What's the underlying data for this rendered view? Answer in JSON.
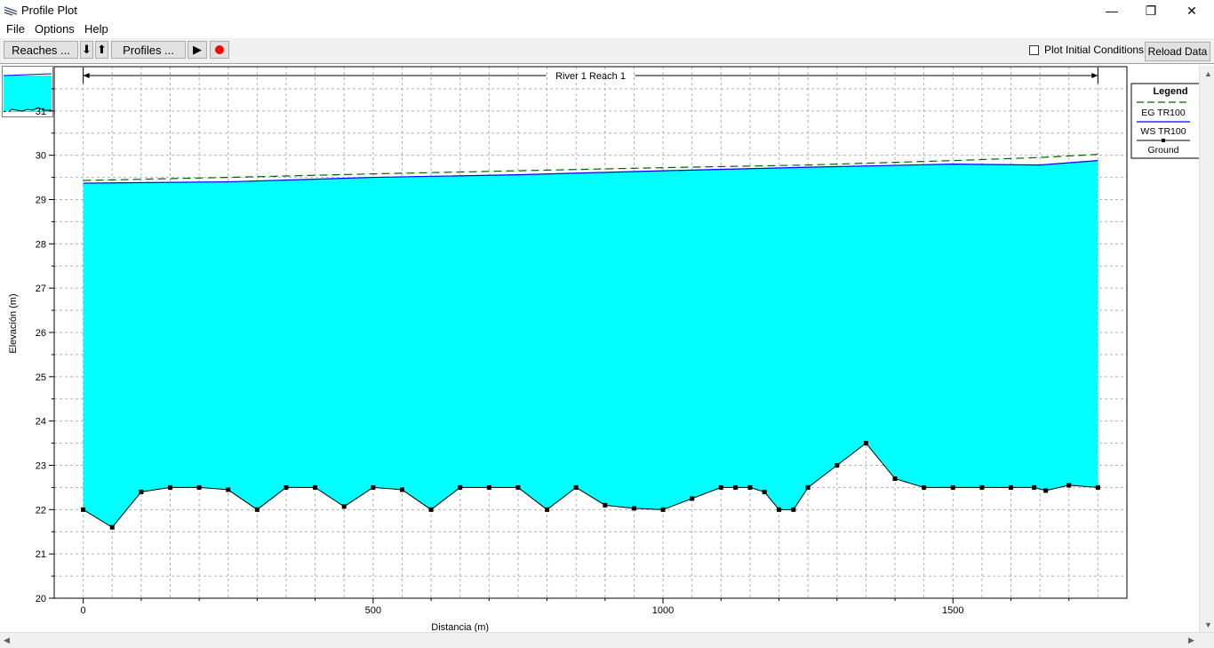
{
  "window": {
    "title": "Profile Plot",
    "minimize": "—",
    "restore": "❐",
    "close": "✕"
  },
  "menu": [
    "File",
    "Options",
    "Help"
  ],
  "toolbar": {
    "reaches_label": "Reaches ...",
    "down_label": "⬇",
    "up_label": "⬆",
    "profiles_label": "Profiles ...",
    "play_label": "▶",
    "record_color": "#ff0000",
    "plot_initial_conditions_label": "Plot Initial Conditions",
    "plot_initial_conditions_checked": false,
    "reload_label": "Reload Data"
  },
  "legend": {
    "title": "Legend",
    "items": [
      {
        "label": "EG  TR100",
        "color": "#006400",
        "style": "dashed"
      },
      {
        "label": "WS  TR100",
        "color": "#0000ff",
        "style": "solid"
      },
      {
        "label": "Ground",
        "color": "#000000",
        "style": "marker"
      }
    ]
  },
  "chart_data": {
    "type": "line",
    "title": "",
    "reach_label": "River 1 Reach 1",
    "xlabel": "Distancia (m)",
    "ylabel": "Elevación (m)",
    "xlim": [
      -50,
      1800
    ],
    "ylim": [
      20,
      32
    ],
    "xticks": [
      0,
      500,
      1000,
      1500
    ],
    "yticks": [
      20,
      21,
      22,
      23,
      24,
      25,
      26,
      27,
      28,
      29,
      30,
      31
    ],
    "grid": true,
    "legend_position": "top-right",
    "water_color": "#00ffff",
    "series": [
      {
        "name": "Ground",
        "color": "#000000",
        "x": [
          0,
          50,
          100,
          150,
          200,
          250,
          300,
          350,
          400,
          450,
          500,
          550,
          600,
          650,
          700,
          750,
          800,
          850,
          900,
          950,
          1000,
          1050,
          1100,
          1125,
          1150,
          1175,
          1200,
          1225,
          1250,
          1300,
          1350,
          1400,
          1450,
          1500,
          1550,
          1600,
          1640,
          1660,
          1700,
          1750
        ],
        "y": [
          22.0,
          21.6,
          22.4,
          22.5,
          22.5,
          22.45,
          22.0,
          22.5,
          22.5,
          22.07,
          22.5,
          22.45,
          22.0,
          22.5,
          22.5,
          22.5,
          22.0,
          22.5,
          22.1,
          22.03,
          22.0,
          22.25,
          22.5,
          22.5,
          22.5,
          22.4,
          22.0,
          22.0,
          22.5,
          23.0,
          23.5,
          22.7,
          22.5,
          22.5,
          22.5,
          22.5,
          22.5,
          22.43,
          22.55,
          22.5
        ]
      },
      {
        "name": "WS TR100",
        "color": "#0000ff",
        "x": [
          0,
          250,
          500,
          750,
          1000,
          1250,
          1500,
          1650,
          1750
        ],
        "y": [
          29.37,
          29.4,
          29.5,
          29.56,
          29.65,
          29.73,
          29.8,
          29.78,
          29.88
        ]
      },
      {
        "name": "EG TR100",
        "color": "#006400",
        "x": [
          0,
          250,
          500,
          750,
          1000,
          1250,
          1500,
          1650,
          1750
        ],
        "y": [
          29.43,
          29.5,
          29.58,
          29.65,
          29.72,
          29.78,
          29.88,
          29.95,
          30.02
        ]
      }
    ]
  }
}
